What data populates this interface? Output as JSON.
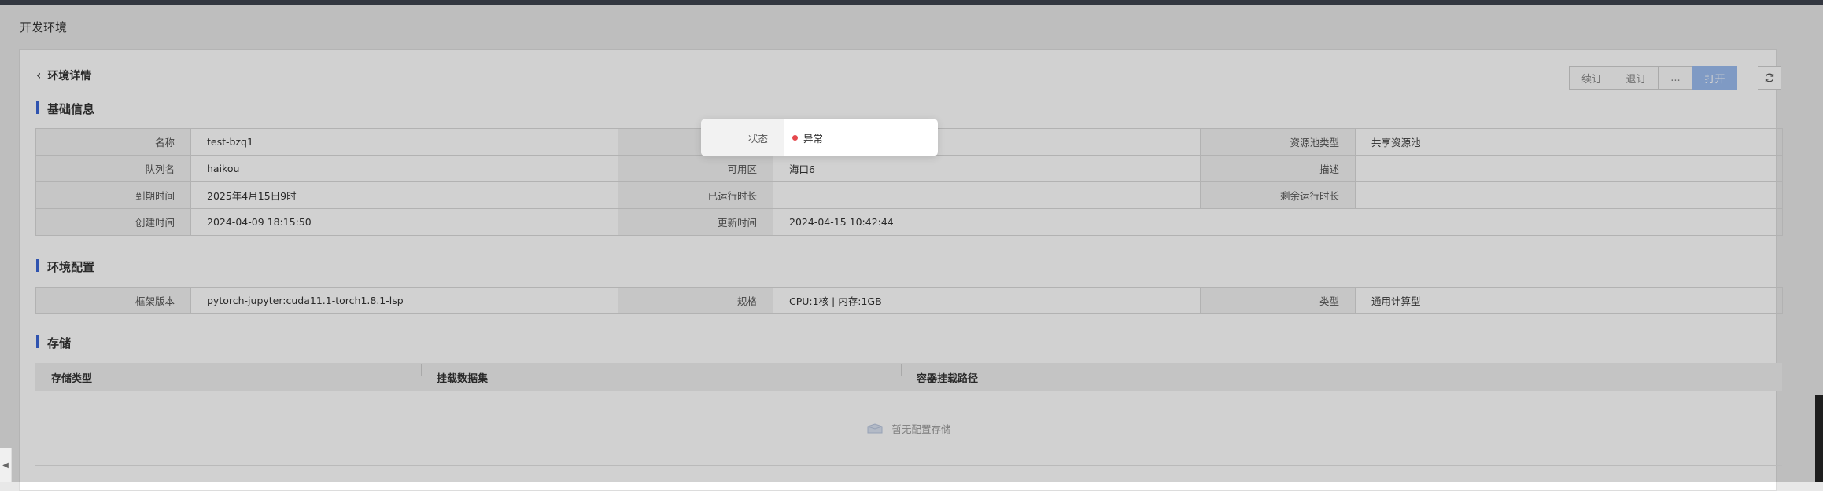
{
  "page_title": "开发环境",
  "header": {
    "back_label": "环境详情",
    "buttons": {
      "renew": "续订",
      "unsubscribe": "退订",
      "more": "...",
      "open": "打开"
    }
  },
  "sections": {
    "basic": "基础信息",
    "config": "环境配置",
    "storage": "存储"
  },
  "basic_info": {
    "name_label": "名称",
    "name": "test-bzq1",
    "status_label": "状态",
    "status": "异常",
    "pool_type_label": "资源池类型",
    "pool_type": "共享资源池",
    "queue_label": "队列名",
    "queue": "haikou",
    "zone_label": "可用区",
    "zone": "海口6",
    "desc_label": "描述",
    "desc": "",
    "expire_label": "到期时间",
    "expire": "2025年4月15日9时",
    "runtime_label": "已运行时长",
    "runtime": "--",
    "remaining_label": "剩余运行时长",
    "remaining": "--",
    "created_label": "创建时间",
    "created": "2024-04-09 18:15:50",
    "updated_label": "更新时间",
    "updated": "2024-04-15 10:42:44"
  },
  "env_config": {
    "framework_label": "框架版本",
    "framework": "pytorch-jupyter:cuda11.1-torch1.8.1-lsp",
    "spec_label": "规格",
    "spec": "CPU:1核 | 内存:1GB",
    "type_label": "类型",
    "type": "通用计算型"
  },
  "storage": {
    "columns": [
      "存储类型",
      "挂载数据集",
      "容器挂载路径"
    ],
    "empty_text": "暂无配置存储"
  },
  "colors": {
    "accent": "#3a66d6",
    "status_error": "#e5484d",
    "primary_button": "#9bbcf0"
  },
  "icons": [
    "back-chevron-icon",
    "refresh-icon",
    "empty-box-icon",
    "status-dot-icon"
  ]
}
